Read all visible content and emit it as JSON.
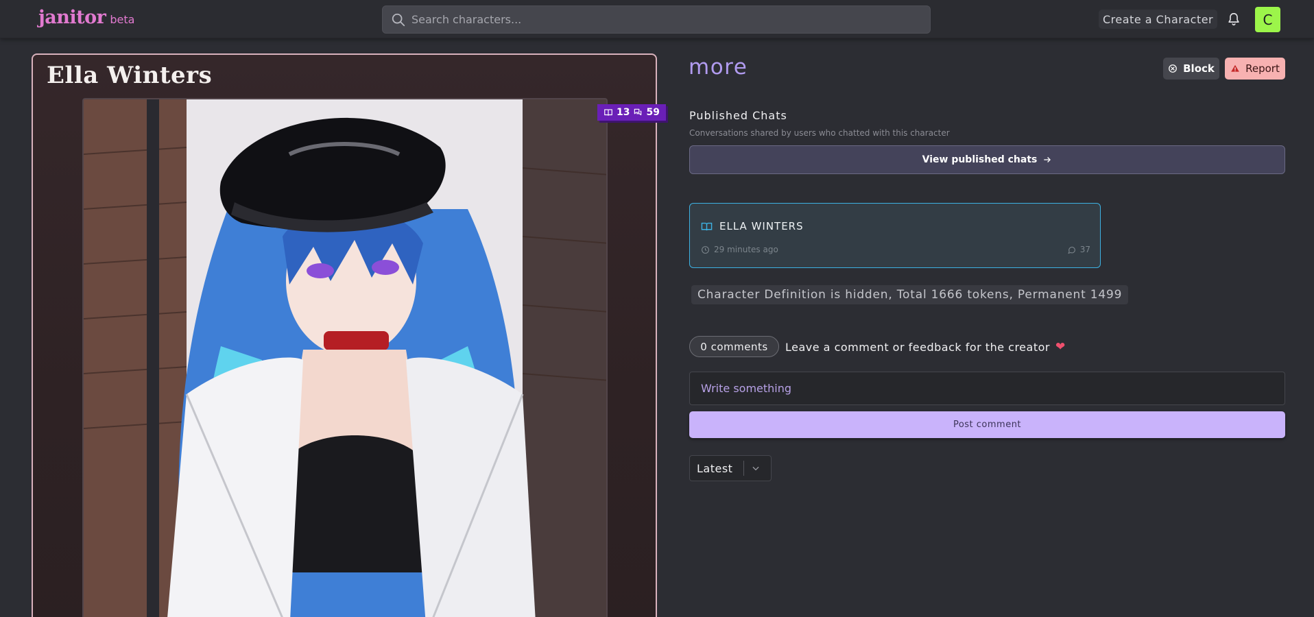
{
  "header": {
    "logo_main": "janitor",
    "logo_beta": "beta",
    "search_placeholder": "Search characters...",
    "create_label": "Create a Character",
    "avatar_letter": "C"
  },
  "character": {
    "name": "Ella Winters",
    "stat_chats": "13",
    "stat_messages": "59"
  },
  "right": {
    "more_title": "more",
    "block_label": "Block",
    "report_label": "Report",
    "published_heading": "Published Chats",
    "published_sub": "Conversations shared by users who chatted with this character",
    "view_published_label": "View published chats",
    "chat_card": {
      "title": "ELLA WINTERS",
      "time": "29 minutes ago",
      "count": "37"
    },
    "token_info": "Character Definition is hidden, Total 1666 tokens, Permanent 1499",
    "comments_count": "0 comments",
    "comment_prompt": "Leave a comment or feedback for the creator",
    "write_placeholder": "Write something",
    "post_label": "Post comment",
    "sort_value": "Latest"
  },
  "colors": {
    "accent_pink": "#e27ad0",
    "accent_purple": "#b19bf0",
    "report_bg": "#f7b1b1",
    "avatar_bg": "#9cf54a",
    "chat_card_border": "#3db2e3"
  }
}
